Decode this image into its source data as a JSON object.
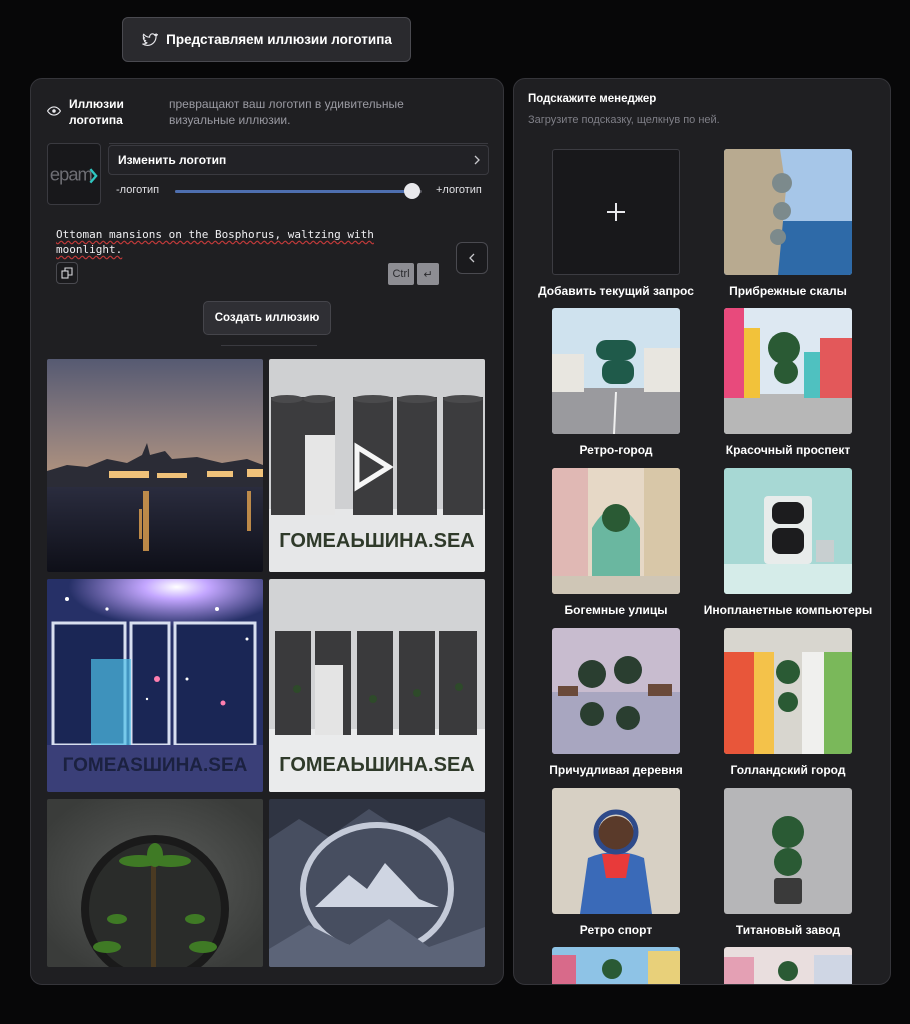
{
  "top_button": {
    "label": "Представляем иллюзии логотипа",
    "icon": "twitter-bird-icon"
  },
  "left_panel": {
    "title": "Иллюзии логотипа",
    "description": "превращают ваш логотип в удивительные визуальные иллюзии.",
    "logo_text": "epam",
    "change_logo_label": "Изменить логотип",
    "slider": {
      "min_label": "-логотип",
      "max_label": "+логотип",
      "level": 0.96
    },
    "prompt_text": "Ottoman mansions on the Bosphorus, waltzing with moonlight.",
    "kbd_ctrl": "Ctrl",
    "kbd_enter": "↵",
    "create_label": "Создать иллюзию",
    "generated_images": [
      {
        "name": "bosphorus-night",
        "overlay_text": ""
      },
      {
        "name": "silos-video",
        "overlay_text": "ГОМЕАЬШИНА.ЅЕА"
      },
      {
        "name": "space-window",
        "overlay_text": "ГОМЕАЅШИНА.ЅЕА"
      },
      {
        "name": "silos-plants",
        "overlay_text": "ГОМЕАЬШИНА.ЅЕА"
      },
      {
        "name": "palm-sphere",
        "overlay_text": ""
      },
      {
        "name": "mountain-circle",
        "overlay_text": ""
      }
    ]
  },
  "right_panel": {
    "title": "Подскажите менеджер",
    "subtitle": "Загрузите подсказку, щелкнув по ней.",
    "add_label": "Добавить текущий запрос",
    "prompts": [
      {
        "label": "Прибрежные скалы"
      },
      {
        "label": "Ретро-город"
      },
      {
        "label": "Красочный проспект"
      },
      {
        "label": "Богемные улицы"
      },
      {
        "label": "Инопланетные компьютеры"
      },
      {
        "label": "Причудливая деревня"
      },
      {
        "label": "Голландский город"
      },
      {
        "label": "Ретро спорт"
      },
      {
        "label": "Титановый завод"
      }
    ]
  },
  "colors": {
    "background": "#070708",
    "panel": "#1f1f22",
    "slider_accent": "#4e6fb0"
  }
}
